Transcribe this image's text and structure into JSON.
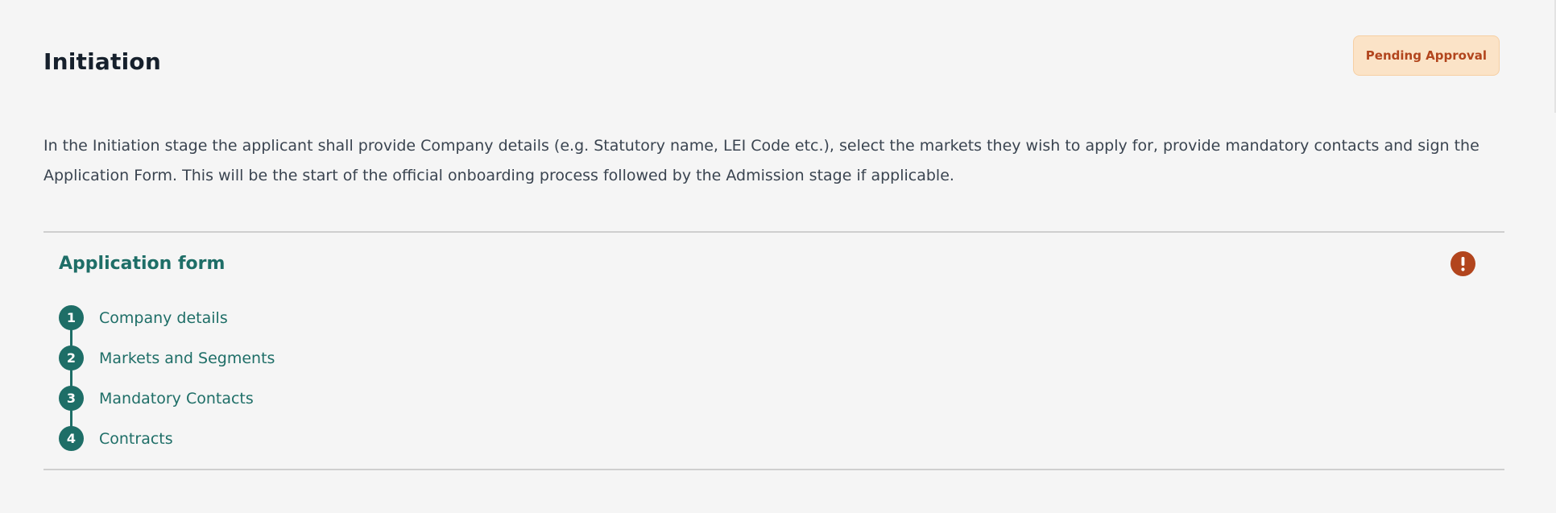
{
  "page": {
    "title": "Initiation",
    "status_badge": "Pending Approval",
    "description": "In the Initiation stage the applicant shall provide Company details (e.g. Statutory name, LEI Code etc.), select the markets they wish to apply for, provide mandatory contacts and sign the Application Form. This will be the start of the official onboarding process followed by the Admission stage if applicable."
  },
  "application_form": {
    "title": "Application form",
    "alert_icon": "exclamation-circle-icon",
    "steps": [
      {
        "number": "1",
        "label": "Company details"
      },
      {
        "number": "2",
        "label": "Markets and Segments"
      },
      {
        "number": "3",
        "label": "Mandatory Contacts"
      },
      {
        "number": "4",
        "label": "Contracts"
      }
    ]
  },
  "colors": {
    "accent": "#1e6e67",
    "badge_background": "#fbe3c7",
    "badge_text": "#b2451d",
    "alert": "#b2451d",
    "background": "#f5f5f5"
  }
}
